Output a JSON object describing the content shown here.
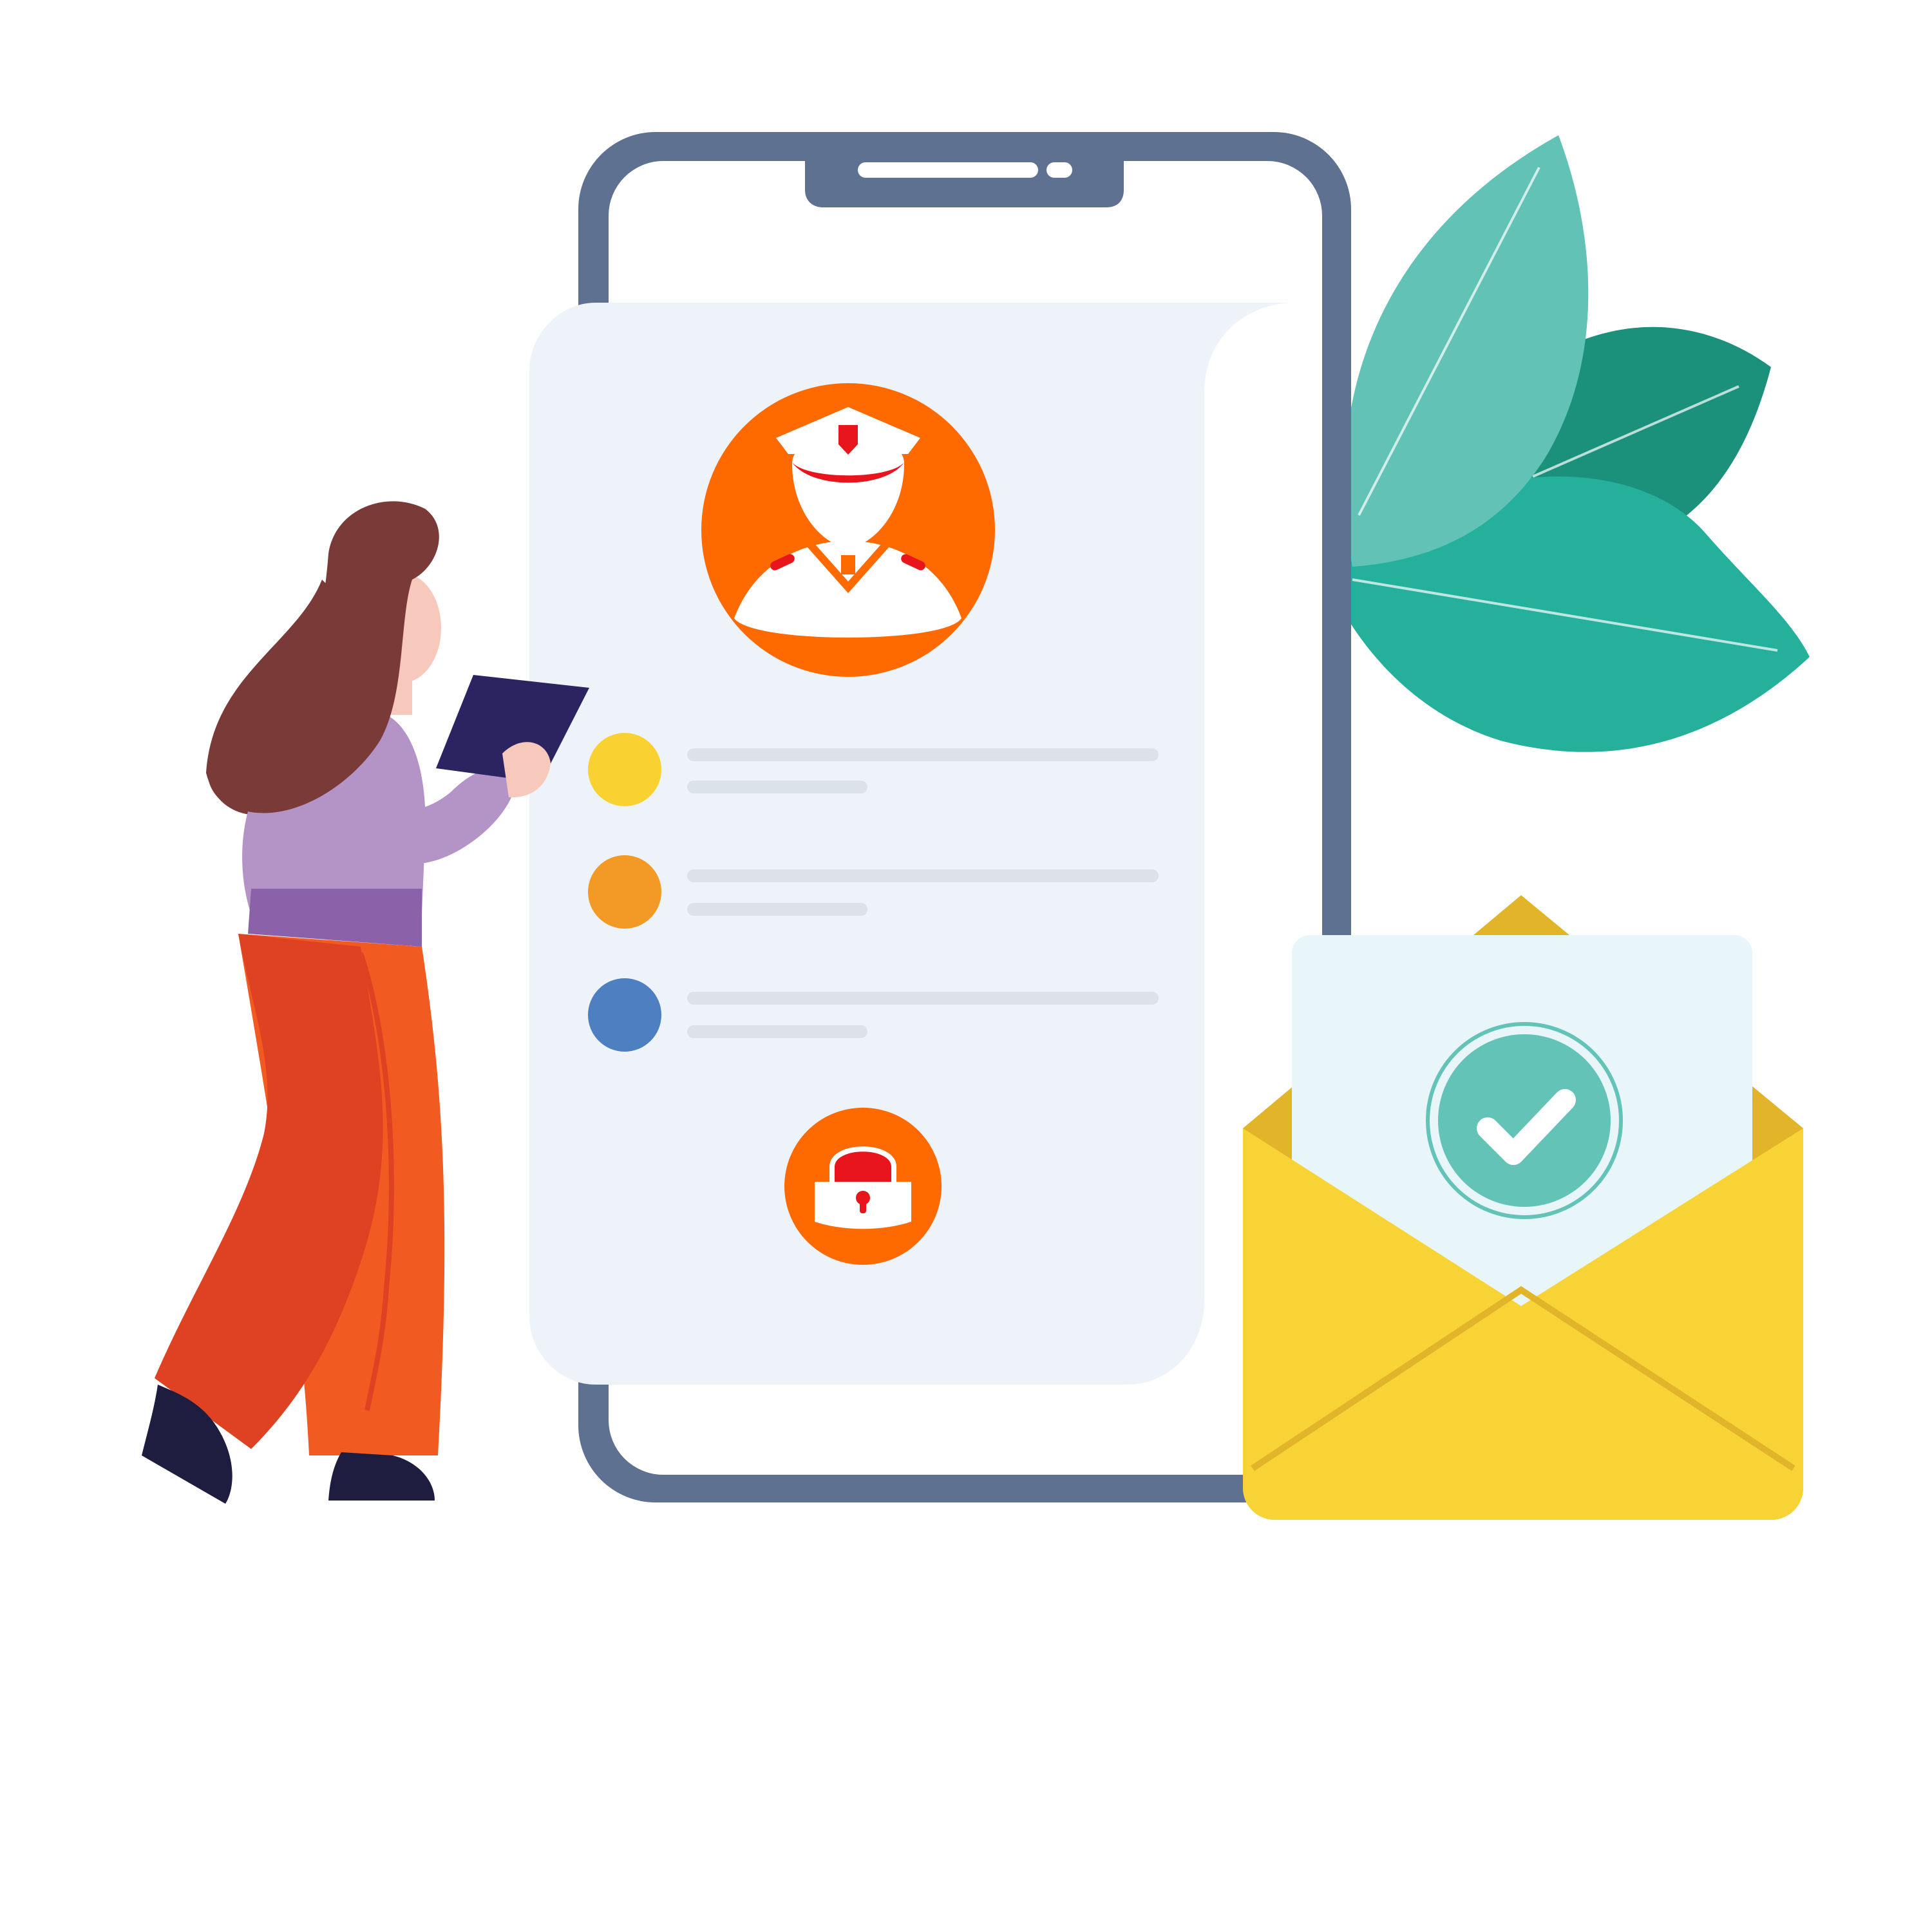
{
  "colors": {
    "background": "#ffffff",
    "phone_frame": "#5f7190",
    "screen": "#ffffff",
    "card": "#eef3f9",
    "skeleton_line": "#dbe2ea",
    "accent_orange": "#ff6a00",
    "accent_red": "#e8161c",
    "dot_yellow": "#f9d232",
    "dot_orange": "#f29a25",
    "dot_blue": "#4e7fc1",
    "leaf_light": "#61c2b5",
    "leaf_dark": "#1b917c",
    "leaf_mid": "#25b09c",
    "envelope_yellow": "#f8d335",
    "envelope_shadow": "#e2b429",
    "letter_paper": "#e8f5f9",
    "check_badge": "#63c3b6",
    "skin": "#f7c9bc",
    "hair": "#7a3a37",
    "sweater": "#b493c6",
    "sweater_dark": "#8b62a9",
    "pants": "#f15b22",
    "pants_shadow": "#de4222",
    "shoes": "#1e1c3f",
    "tablet": "#2b2461"
  },
  "icons": [
    "security-guard-icon",
    "padlock-icon",
    "checkmark-icon",
    "envelope-icon",
    "smartphone-icon",
    "leaves-icon",
    "woman-with-tablet-icon"
  ],
  "list_items": [
    {
      "dot_color": "#f9d232"
    },
    {
      "dot_color": "#f29a25"
    },
    {
      "dot_color": "#4e7fc1"
    }
  ]
}
